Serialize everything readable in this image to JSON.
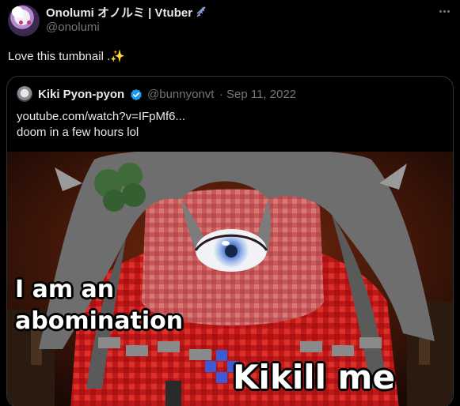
{
  "author": {
    "display_name": "Onolumi オノルミ | Vtuber",
    "name_icon": "dna-icon",
    "handle": "@onolumi",
    "avatar": "avatar-image"
  },
  "tweet": {
    "text": "Love this tumbnail .",
    "emoji": "✨"
  },
  "more_icon": "more-dots-icon",
  "quoted": {
    "display_name": "Kiki Pyon-pyon",
    "verified_icon": "verified-badge-icon",
    "handle": "@bunnyonvt",
    "separator": "·",
    "date": "Sep 11, 2022",
    "line1": "youtube.com/watch?v=IFpMf6...",
    "line2": "doom in a few hours lol",
    "thumbnail": {
      "caption_line1": "I am an",
      "caption_line2": "abomination",
      "caption_main": "Kikill me"
    }
  },
  "colors": {
    "background": "#000000",
    "text_primary": "#e7e9ea",
    "text_secondary": "#71767b",
    "border": "#2f3336",
    "verified": "#1d9bf0",
    "thumb_red": "#c8201c"
  }
}
